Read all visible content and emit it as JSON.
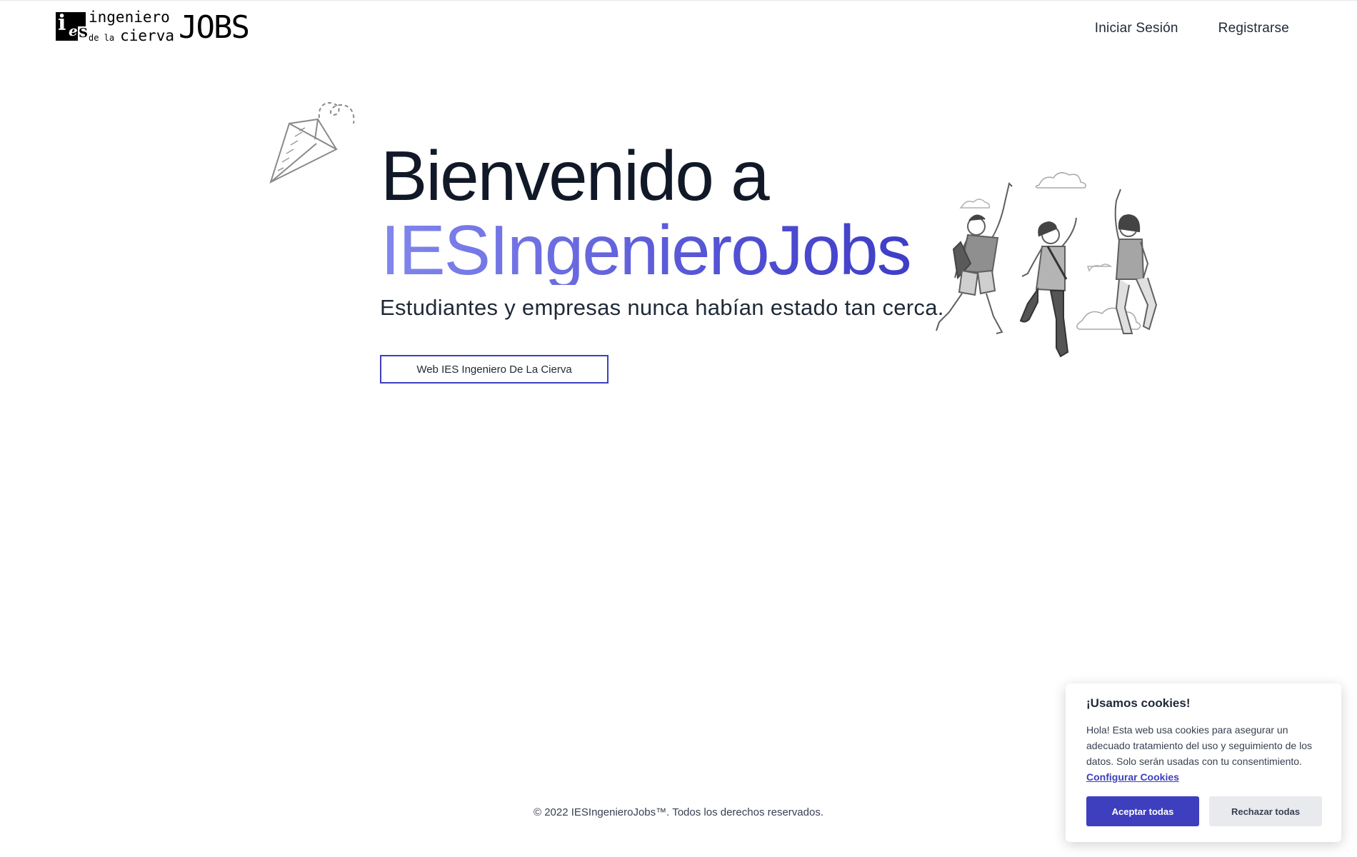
{
  "header": {
    "logo": {
      "letters": "IeS",
      "line1": "ingeniero",
      "line2_small": "de la",
      "line2": "cierva",
      "jobs": "JOBS"
    },
    "nav": {
      "login_label": "Iniciar Sesión",
      "register_label": "Registrarse"
    }
  },
  "hero": {
    "title_line1": "Bienvenido a",
    "title_line2": "IESIngenieroJobs",
    "subtitle": "Estudiantes y empresas nunca habían estado tan cerca.",
    "cta_label": "Web IES Ingeniero De La Cierva",
    "gradient_colors": [
      "#8187ec",
      "#3e3dc6"
    ],
    "illustrations": [
      "paper-plane-icon",
      "jumping-students-illustration"
    ]
  },
  "footer": {
    "copyright": "© 2022 IESIngenieroJobs™. Todos los derechos reservados."
  },
  "cookie_banner": {
    "title": "¡Usamos cookies!",
    "text": "Hola! Esta web usa cookies para asegurar un adecuado tratamiento del uso y seguimiento de los datos. Solo serán usadas con tu consentimiento.",
    "configure_label": "Configurar Cookies",
    "accept_label": "Aceptar todas",
    "reject_label": "Rechazar todas",
    "accent_color": "#3d3fbf"
  }
}
